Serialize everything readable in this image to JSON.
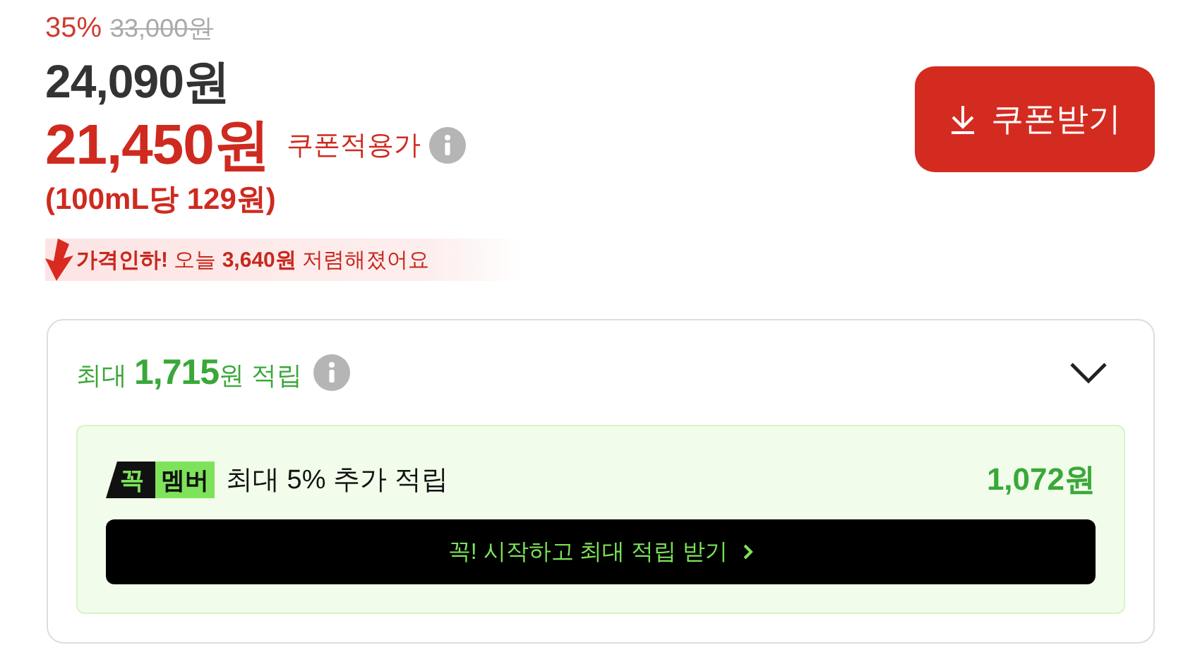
{
  "price": {
    "discount_rate": "35%",
    "original_price": "33,000원",
    "sale_price": "24,090원",
    "coupon_price": "21,450원",
    "coupon_label": "쿠폰적용가",
    "unit_price": "(100mL당 129원)"
  },
  "price_drop": {
    "text": "**가격인하!** 오늘 **3,640원** 저렴해졌어요"
  },
  "coupon_button": {
    "label": "쿠폰받기"
  },
  "rewards": {
    "expanded": false,
    "summary": "최대 **1,715**원 적립",
    "member": {
      "badge_left": "꼭",
      "badge_right": "멤버",
      "text": "최대 5% 추가 적립",
      "amount": "1,072원"
    },
    "cta": {
      "label": "꼭! 시작하고 최대 적립 받기"
    }
  }
}
